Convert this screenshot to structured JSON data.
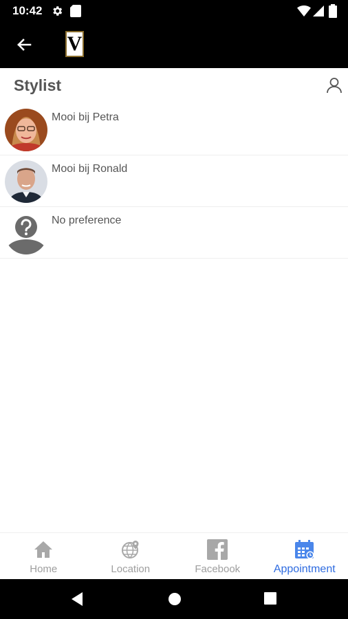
{
  "status_bar": {
    "time": "10:42",
    "icons": [
      "settings-icon",
      "sd-card-icon",
      "wifi-icon",
      "signal-icon",
      "battery-icon"
    ]
  },
  "app_bar": {
    "logo_text": "V",
    "back_icon": "arrow-left-icon"
  },
  "header": {
    "title": "Stylist",
    "profile_icon": "person-outline-icon"
  },
  "stylists": [
    {
      "name": "Mooi bij Petra",
      "avatar": "photo-woman"
    },
    {
      "name": "Mooi bij Ronald",
      "avatar": "photo-man"
    },
    {
      "name": "No preference",
      "avatar": "unknown-person-icon"
    }
  ],
  "bottom_nav": {
    "items": [
      {
        "label": "Home",
        "icon": "home-icon",
        "active": false
      },
      {
        "label": "Location",
        "icon": "globe-pin-icon",
        "active": false
      },
      {
        "label": "Facebook",
        "icon": "facebook-icon",
        "active": false
      },
      {
        "label": "Appointment",
        "icon": "calendar-icon",
        "active": true
      }
    ]
  },
  "colors": {
    "accent": "#2f6ce0",
    "inactive": "#9e9e9e",
    "bar_background": "#000000",
    "title": "#555555"
  }
}
